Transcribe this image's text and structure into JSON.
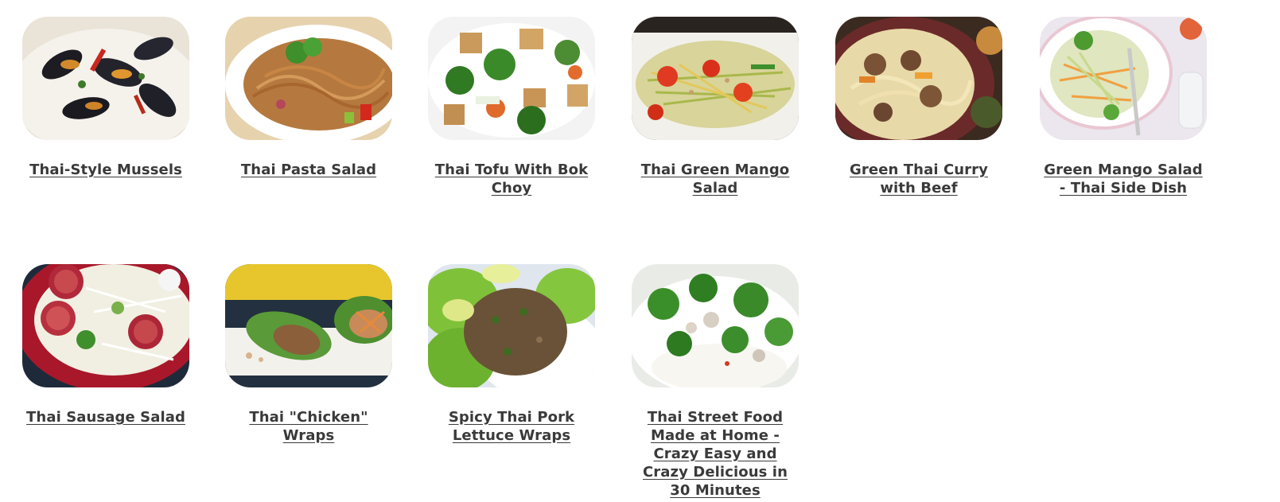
{
  "recipes": [
    {
      "title": "Thai-Style Mussels",
      "image": "mussels-photo"
    },
    {
      "title": "Thai Pasta Salad",
      "image": "pasta-salad-photo"
    },
    {
      "title": "Thai Tofu With Bok Choy",
      "image": "tofu-bok-choy-photo"
    },
    {
      "title": "Thai Green Mango Salad",
      "image": "green-mango-salad-photo"
    },
    {
      "title": "Green Thai Curry with Beef",
      "image": "curry-beef-photo"
    },
    {
      "title": "Green Mango Salad - Thai Side Dish",
      "image": "mango-side-dish-photo"
    },
    {
      "title": "Thai Sausage Salad",
      "image": "sausage-salad-photo"
    },
    {
      "title": "Thai \"Chicken\" Wraps",
      "image": "chicken-wraps-photo"
    },
    {
      "title": "Spicy Thai Pork Lettuce Wraps",
      "image": "pork-lettuce-wraps-photo"
    },
    {
      "title": "Thai Street Food Made at Home - Crazy Easy and Crazy Delicious in 30 Minutes",
      "image": "street-food-photo"
    }
  ]
}
